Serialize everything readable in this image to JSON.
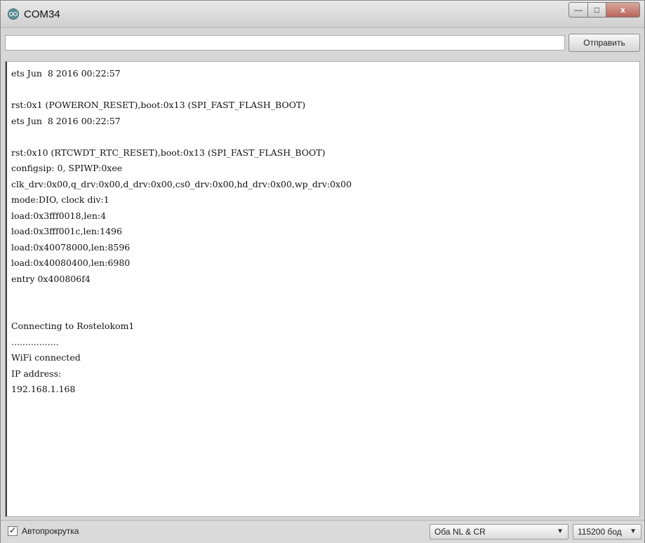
{
  "window": {
    "title": "COM34",
    "controls": {
      "minimize": "—",
      "maximize": "□",
      "close": "x"
    }
  },
  "send_bar": {
    "input_value": "",
    "button_label": "Отправить"
  },
  "console": {
    "lines": [
      "ets Jun  8 2016 00:22:57",
      "",
      "rst:0x1 (POWERON_RESET),boot:0x13 (SPI_FAST_FLASH_BOOT)",
      "ets Jun  8 2016 00:22:57",
      "",
      "rst:0x10 (RTCWDT_RTC_RESET),boot:0x13 (SPI_FAST_FLASH_BOOT)",
      "configsip: 0, SPIWP:0xee",
      "clk_drv:0x00,q_drv:0x00,d_drv:0x00,cs0_drv:0x00,hd_drv:0x00,wp_drv:0x00",
      "mode:DIO, clock div:1",
      "load:0x3fff0018,len:4",
      "load:0x3fff001c,len:1496",
      "load:0x40078000,len:8596",
      "load:0x40080400,len:6980",
      "entry 0x400806f4",
      "",
      "",
      "Connecting to Rostelokom1",
      ".................",
      "WiFi connected",
      "IP address:",
      "192.168.1.168"
    ]
  },
  "footer": {
    "autoscroll_label": "Автопрокрутка",
    "autoscroll_checked": true,
    "line_ending_value": "Оба NL & CR",
    "baud_value": "115200 бод"
  },
  "icons": {
    "app": "arduino-logo-icon",
    "dropdown": "chevron-down-icon"
  }
}
